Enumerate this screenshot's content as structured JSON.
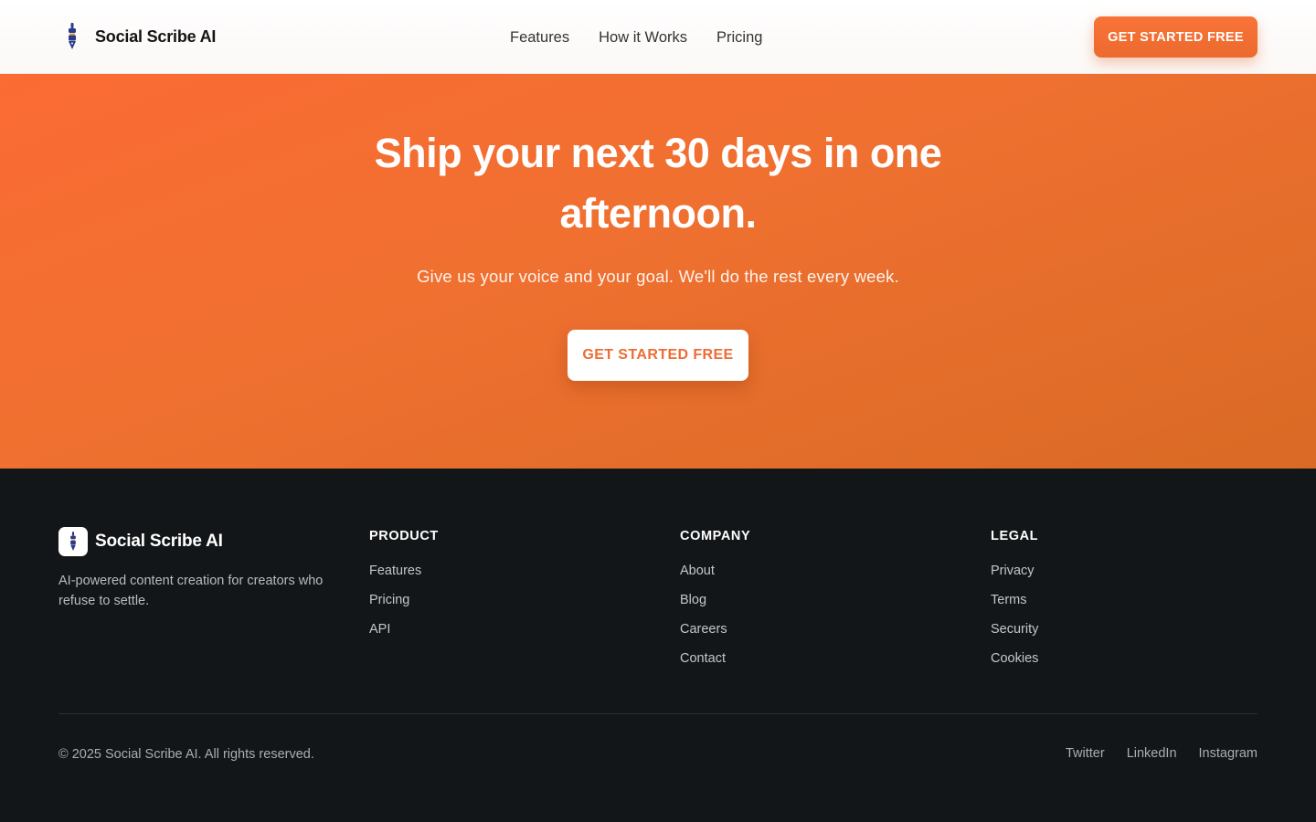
{
  "brand": {
    "name": "Social Scribe AI",
    "logo_icon": "pen-nib-icon"
  },
  "nav": {
    "items": [
      {
        "label": "Features"
      },
      {
        "label": "How it Works"
      },
      {
        "label": "Pricing"
      }
    ],
    "cta_label": "GET STARTED FREE"
  },
  "hero": {
    "title": "Ship your next 30 days in one afternoon.",
    "subtitle": "Give us your voice and your goal. We'll do the rest every week.",
    "cta_label": "GET STARTED FREE"
  },
  "footer": {
    "brand_name": "Social Scribe AI",
    "tagline": "AI-powered content creation for creators who refuse to settle.",
    "columns": [
      {
        "heading": "PRODUCT",
        "links": [
          "Features",
          "Pricing",
          "API"
        ]
      },
      {
        "heading": "COMPANY",
        "links": [
          "About",
          "Blog",
          "Careers",
          "Contact"
        ]
      },
      {
        "heading": "LEGAL",
        "links": [
          "Privacy",
          "Terms",
          "Security",
          "Cookies"
        ]
      }
    ],
    "copyright": "© 2025 Social Scribe AI. All rights reserved.",
    "social": [
      "Twitter",
      "LinkedIn",
      "Instagram"
    ]
  },
  "colors": {
    "accent": "#F06C30",
    "hero_gradient_start": "#FB6B34",
    "hero_gradient_end": "#D96A25",
    "footer_bg": "#131618"
  }
}
